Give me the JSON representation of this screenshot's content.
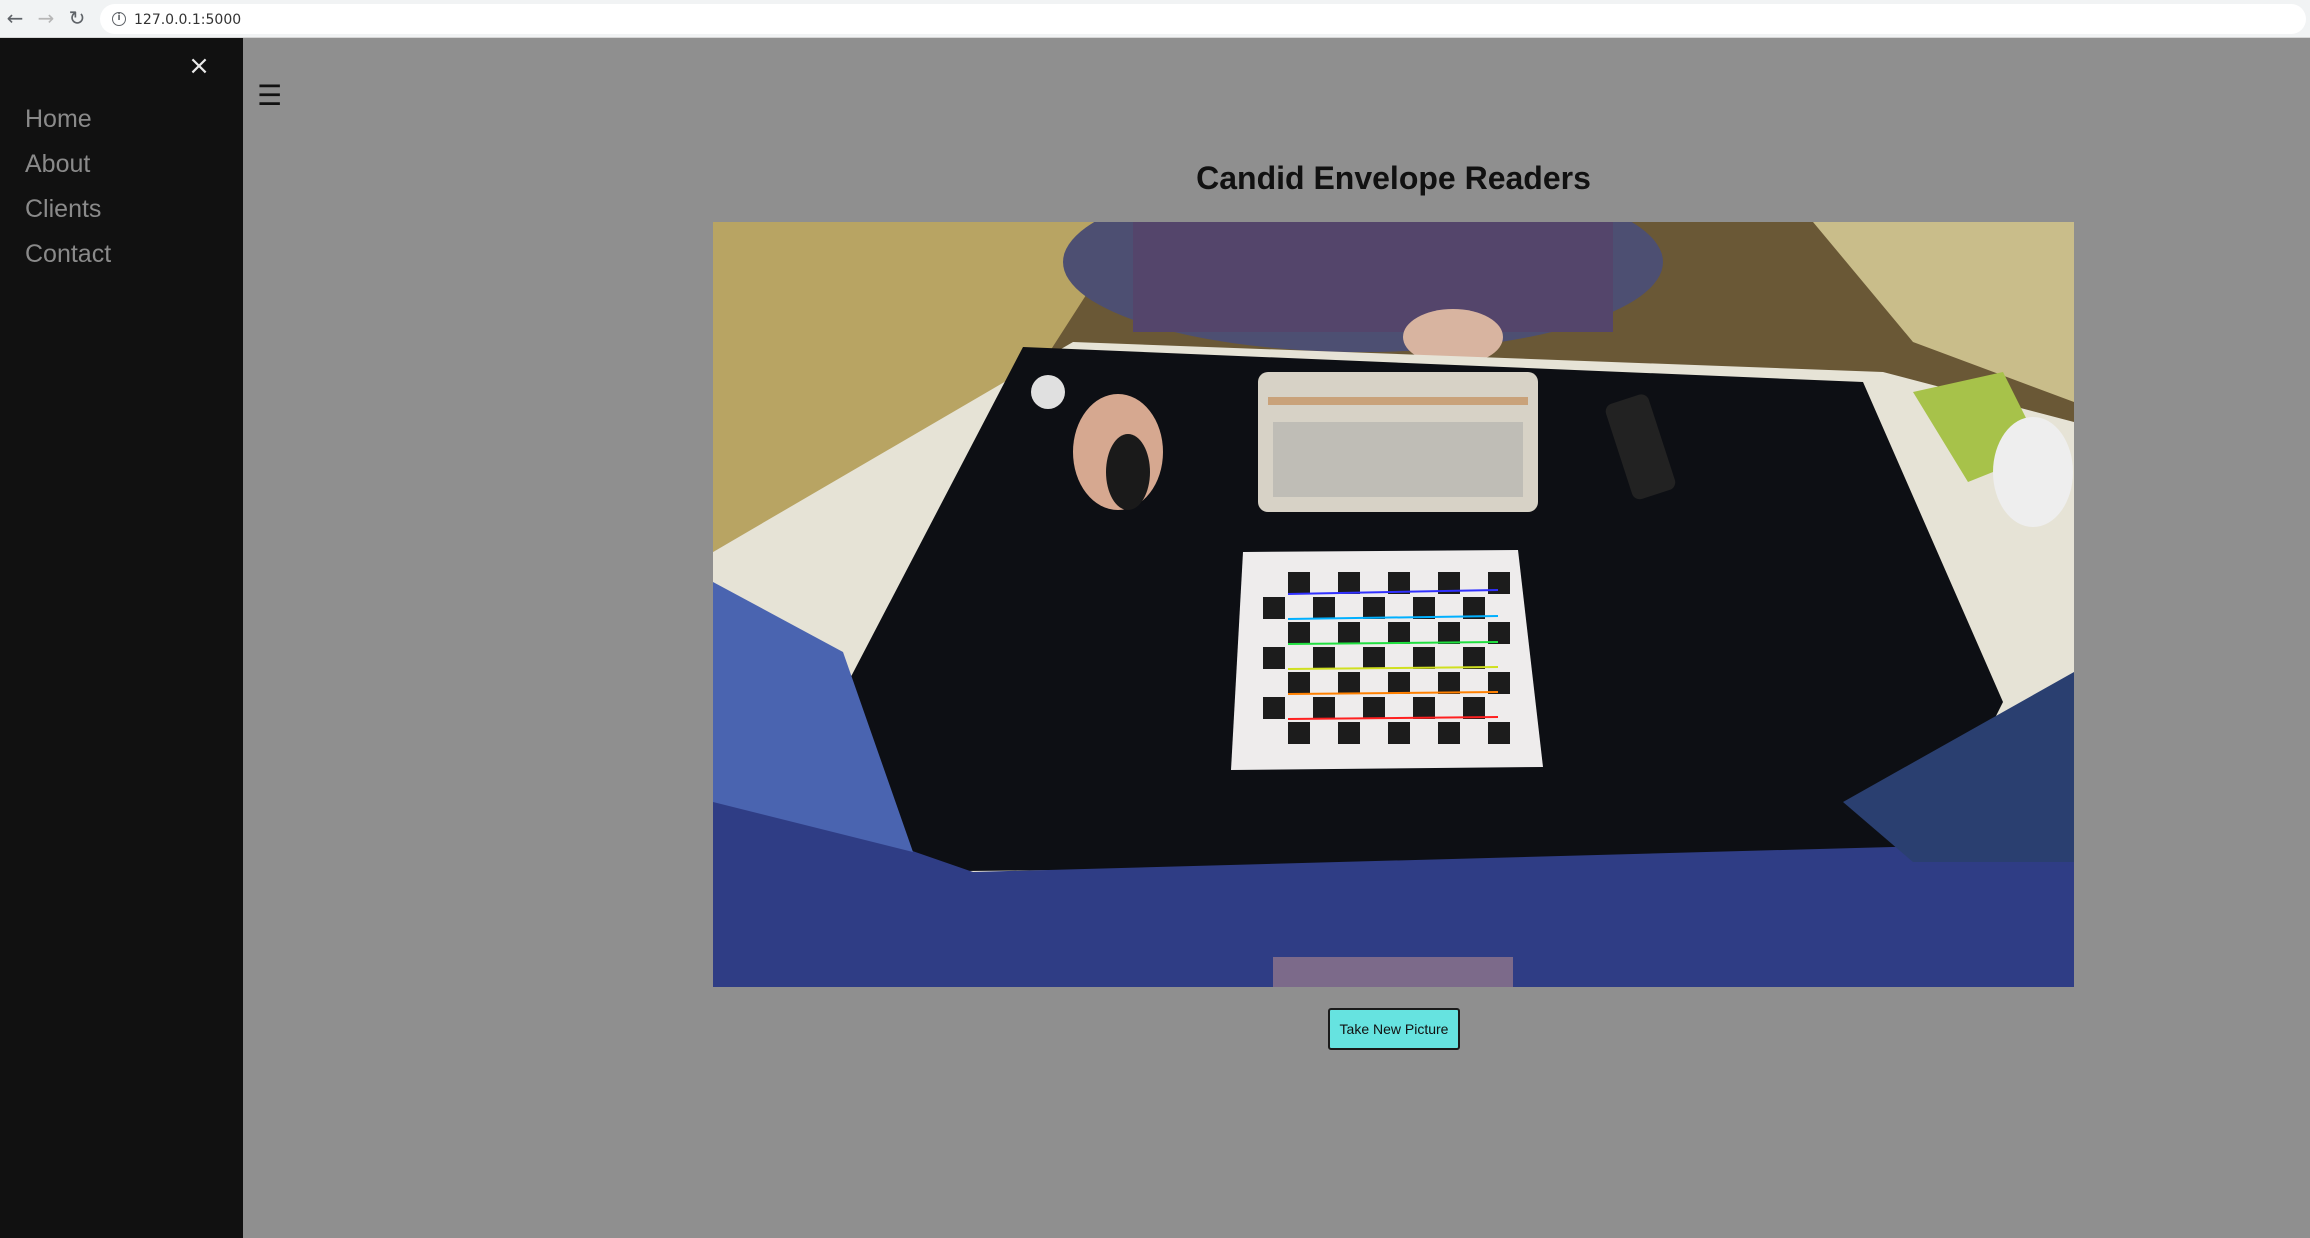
{
  "browser": {
    "url": "127.0.0.1:5000",
    "back_icon": "arrow-left-icon",
    "forward_icon": "arrow-right-icon",
    "reload_icon": "reload-icon",
    "info_icon": "info-icon"
  },
  "sidebar": {
    "close_icon": "close-icon",
    "items": [
      {
        "label": "Home"
      },
      {
        "label": "About"
      },
      {
        "label": "Clients"
      },
      {
        "label": "Contact"
      }
    ]
  },
  "main": {
    "menu_icon": "hamburger-icon",
    "title": "Candid Envelope Readers",
    "image_subject": "Overhead camera view of a desk with keyboard, mouse, phone and a calibration checkerboard with detected corner lines",
    "take_picture_label": "Take New Picture"
  },
  "colors": {
    "page_bg": "#8f8f8f",
    "sidebar_bg": "#111111",
    "sidebar_text": "#8a8a8a",
    "button_bg": "#66e3e0"
  }
}
